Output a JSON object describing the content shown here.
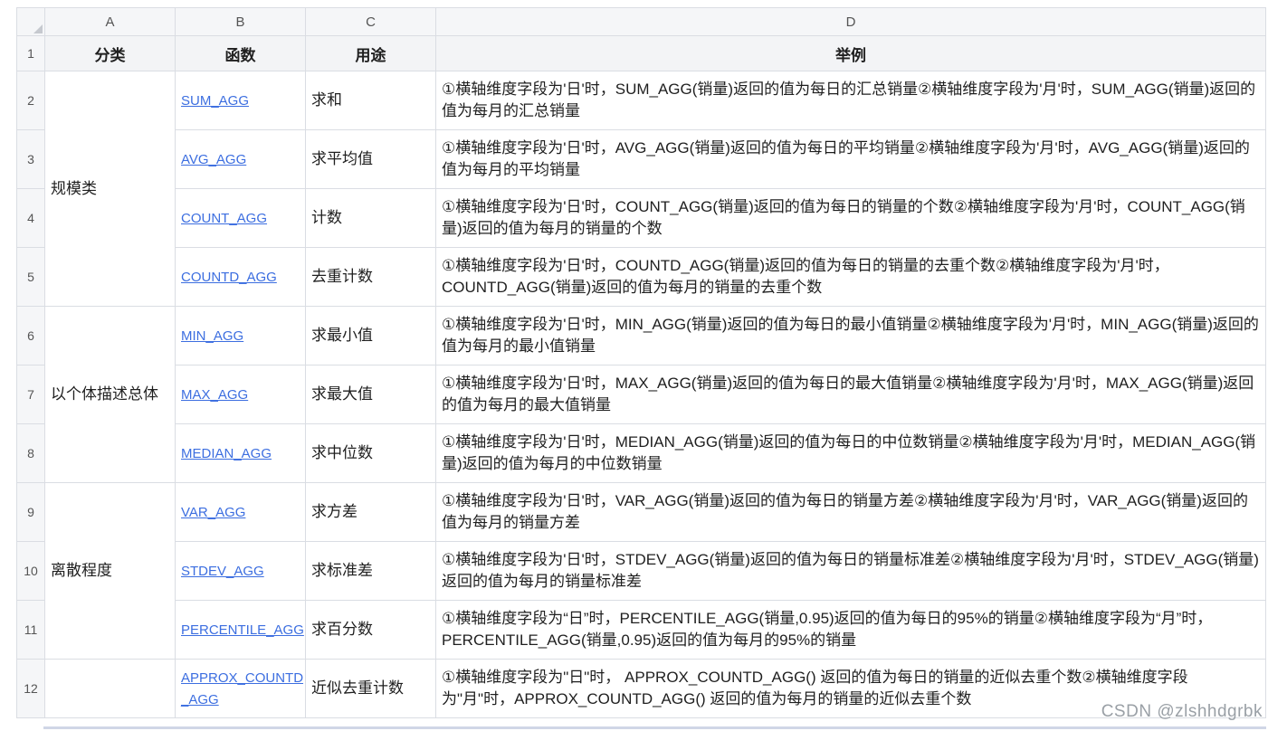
{
  "columns": [
    "A",
    "B",
    "C",
    "D"
  ],
  "row_numbers": [
    "1",
    "2",
    "3",
    "4",
    "5",
    "6",
    "7",
    "8",
    "9",
    "10",
    "11",
    "12"
  ],
  "header": {
    "category": "分类",
    "function": "函数",
    "purpose": "用途",
    "example": "举例"
  },
  "categories": [
    "规模类",
    "以个体描述总体",
    "离散程度",
    ""
  ],
  "rows": [
    {
      "func": "SUM_AGG",
      "purpose": "求和",
      "example": "①横轴维度字段为'日'时，SUM_AGG(销量)返回的值为每日的汇总销量②横轴维度字段为'月'时，SUM_AGG(销量)返回的值为每月的汇总销量"
    },
    {
      "func": "AVG_AGG",
      "purpose": "求平均值",
      "example": "①横轴维度字段为'日'时，AVG_AGG(销量)返回的值为每日的平均销量②横轴维度字段为'月'时，AVG_AGG(销量)返回的值为每月的平均销量"
    },
    {
      "func": "COUNT_AGG",
      "purpose": "计数",
      "example": "①横轴维度字段为'日'时，COUNT_AGG(销量)返回的值为每日的销量的个数②横轴维度字段为'月'时，COUNT_AGG(销量)返回的值为每月的销量的个数"
    },
    {
      "func": "COUNTD_AGG",
      "purpose": "去重计数",
      "example": "①横轴维度字段为'日'时，COUNTD_AGG(销量)返回的值为每日的销量的去重个数②横轴维度字段为'月'时，COUNTD_AGG(销量)返回的值为每月的销量的去重个数"
    },
    {
      "func": "MIN_AGG",
      "purpose": "求最小值",
      "example": "①横轴维度字段为'日'时，MIN_AGG(销量)返回的值为每日的最小值销量②横轴维度字段为'月'时，MIN_AGG(销量)返回的值为每月的最小值销量"
    },
    {
      "func": "MAX_AGG",
      "purpose": "求最大值",
      "example": "①横轴维度字段为'日'时，MAX_AGG(销量)返回的值为每日的最大值销量②横轴维度字段为'月'时，MAX_AGG(销量)返回的值为每月的最大值销量"
    },
    {
      "func": "MEDIAN_AGG",
      "purpose": "求中位数",
      "example": "①横轴维度字段为'日'时，MEDIAN_AGG(销量)返回的值为每日的中位数销量②横轴维度字段为'月'时，MEDIAN_AGG(销量)返回的值为每月的中位数销量"
    },
    {
      "func": "VAR_AGG",
      "purpose": "求方差",
      "example": "①横轴维度字段为'日'时，VAR_AGG(销量)返回的值为每日的销量方差②横轴维度字段为'月'时，VAR_AGG(销量)返回的值为每月的销量方差"
    },
    {
      "func": "STDEV_AGG",
      "purpose": "求标准差",
      "example": "①横轴维度字段为'日'时，STDEV_AGG(销量)返回的值为每日的销量标准差②横轴维度字段为'月'时，STDEV_AGG(销量)返回的值为每月的销量标准差"
    },
    {
      "func": "PERCENTILE_AGG",
      "purpose": "求百分数",
      "example": "①横轴维度字段为“日”时，PERCENTILE_AGG(销量,0.95)返回的值为每日的95%的销量②横轴维度字段为“月”时，PERCENTILE_AGG(销量,0.95)返回的值为每月的95%的销量"
    },
    {
      "func": "APPROX_COUNTD_AGG",
      "purpose": "近似去重计数",
      "example": "①横轴维度字段为\"日\"时， APPROX_COUNTD_AGG() 返回的值为每日的销量的近似去重个数②横轴维度字段为\"月\"时，APPROX_COUNTD_AGG() 返回的值为每月的销量的近似去重个数"
    }
  ],
  "watermark": "CSDN @zlshhdgrbk",
  "colors": {
    "link": "#3c6ee0",
    "header_bg": "#f5f6f8",
    "grid": "#dadde3"
  }
}
